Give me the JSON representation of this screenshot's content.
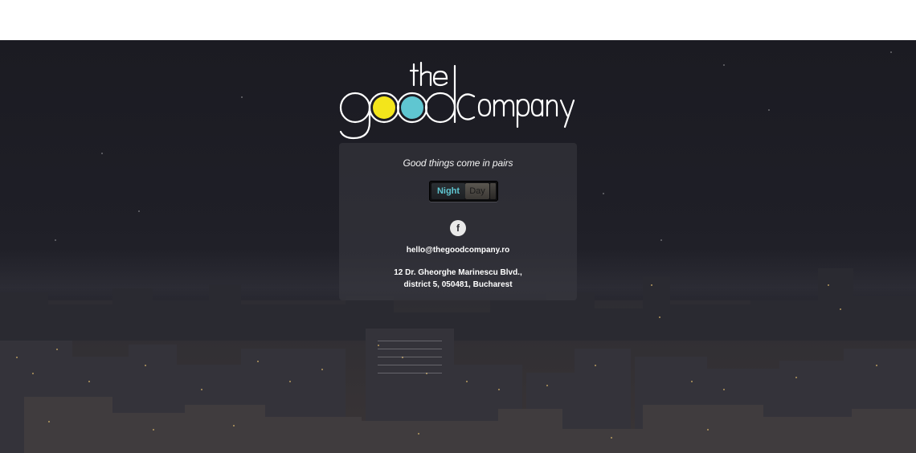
{
  "brand": {
    "logo_the": "the",
    "logo_good": "good",
    "logo_company": "Company",
    "colors": {
      "dot_yellow": "#f3e51b",
      "dot_cyan": "#5fc6d1"
    }
  },
  "panel": {
    "tagline": "Good things come in pairs",
    "toggle": {
      "night_label": "Night",
      "day_label": "Day",
      "selected": "Night"
    },
    "social": {
      "facebook_icon": "f"
    },
    "email": "hello@thegoodcompany.ro",
    "address": {
      "line1": "12 Dr. Gheorghe Marinescu Blvd.,",
      "line2": "district 5, 050481, Bucharest"
    }
  }
}
